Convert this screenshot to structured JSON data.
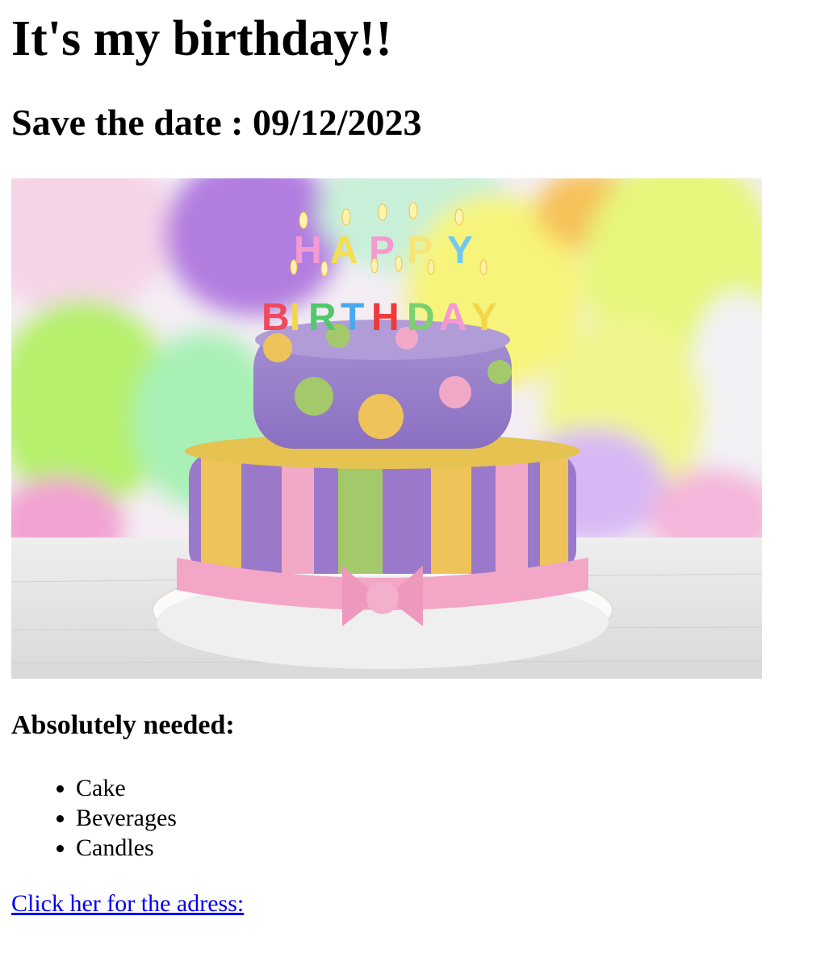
{
  "heading": "It's my birthday!!",
  "subheading": "Save the date : 09/12/2023",
  "image": {
    "subject": "birthday-cake-with-balloons",
    "cake_candle_letters": "HAPPY BIRTHDAY"
  },
  "needed_heading": "Absolutely needed:",
  "needed_items": [
    "Cake",
    "Beverages",
    "Candles"
  ],
  "address_link": "Click her for the adress:",
  "colors": {
    "link": "#0000ee",
    "cake_purple": "#9c7dc9",
    "cake_yellow": "#eec35a",
    "cake_green": "#a4c96a",
    "cake_pink": "#f2a9c8"
  }
}
